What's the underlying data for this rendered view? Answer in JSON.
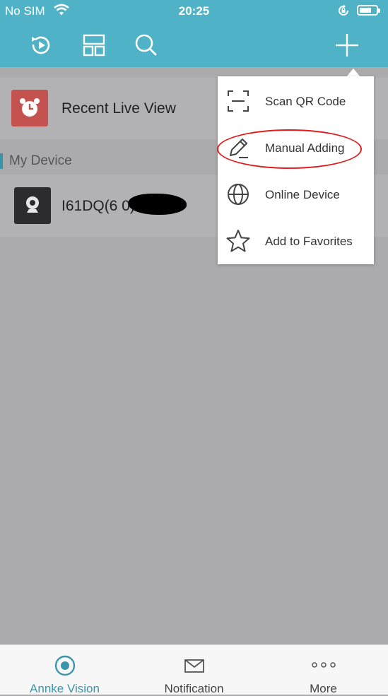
{
  "status_bar": {
    "carrier": "No SIM",
    "time": "20:25"
  },
  "toolbar": {
    "icons": [
      "playback-icon",
      "layout-icon",
      "search-icon",
      "add-icon"
    ]
  },
  "list": {
    "recent_label": "Recent Live View",
    "section_title": "My Device",
    "device_label": "I61DQ(6          0)"
  },
  "menu": {
    "items": [
      {
        "label": "Scan QR Code",
        "icon": "scan-qr-icon"
      },
      {
        "label": "Manual Adding",
        "icon": "pencil-icon"
      },
      {
        "label": "Online Device",
        "icon": "globe-icon"
      },
      {
        "label": "Add to Favorites",
        "icon": "star-icon"
      }
    ]
  },
  "tabbar": {
    "items": [
      {
        "label": "Annke Vision",
        "icon": "live-view-icon",
        "active": true
      },
      {
        "label": "Notification",
        "icon": "envelope-icon",
        "active": false
      },
      {
        "label": "More",
        "icon": "more-dots-icon",
        "active": false
      }
    ]
  },
  "colors": {
    "header": "#4fb2c6",
    "accent": "#3b95aa",
    "overlay": "#ababad",
    "highlight": "#e01c1c"
  }
}
